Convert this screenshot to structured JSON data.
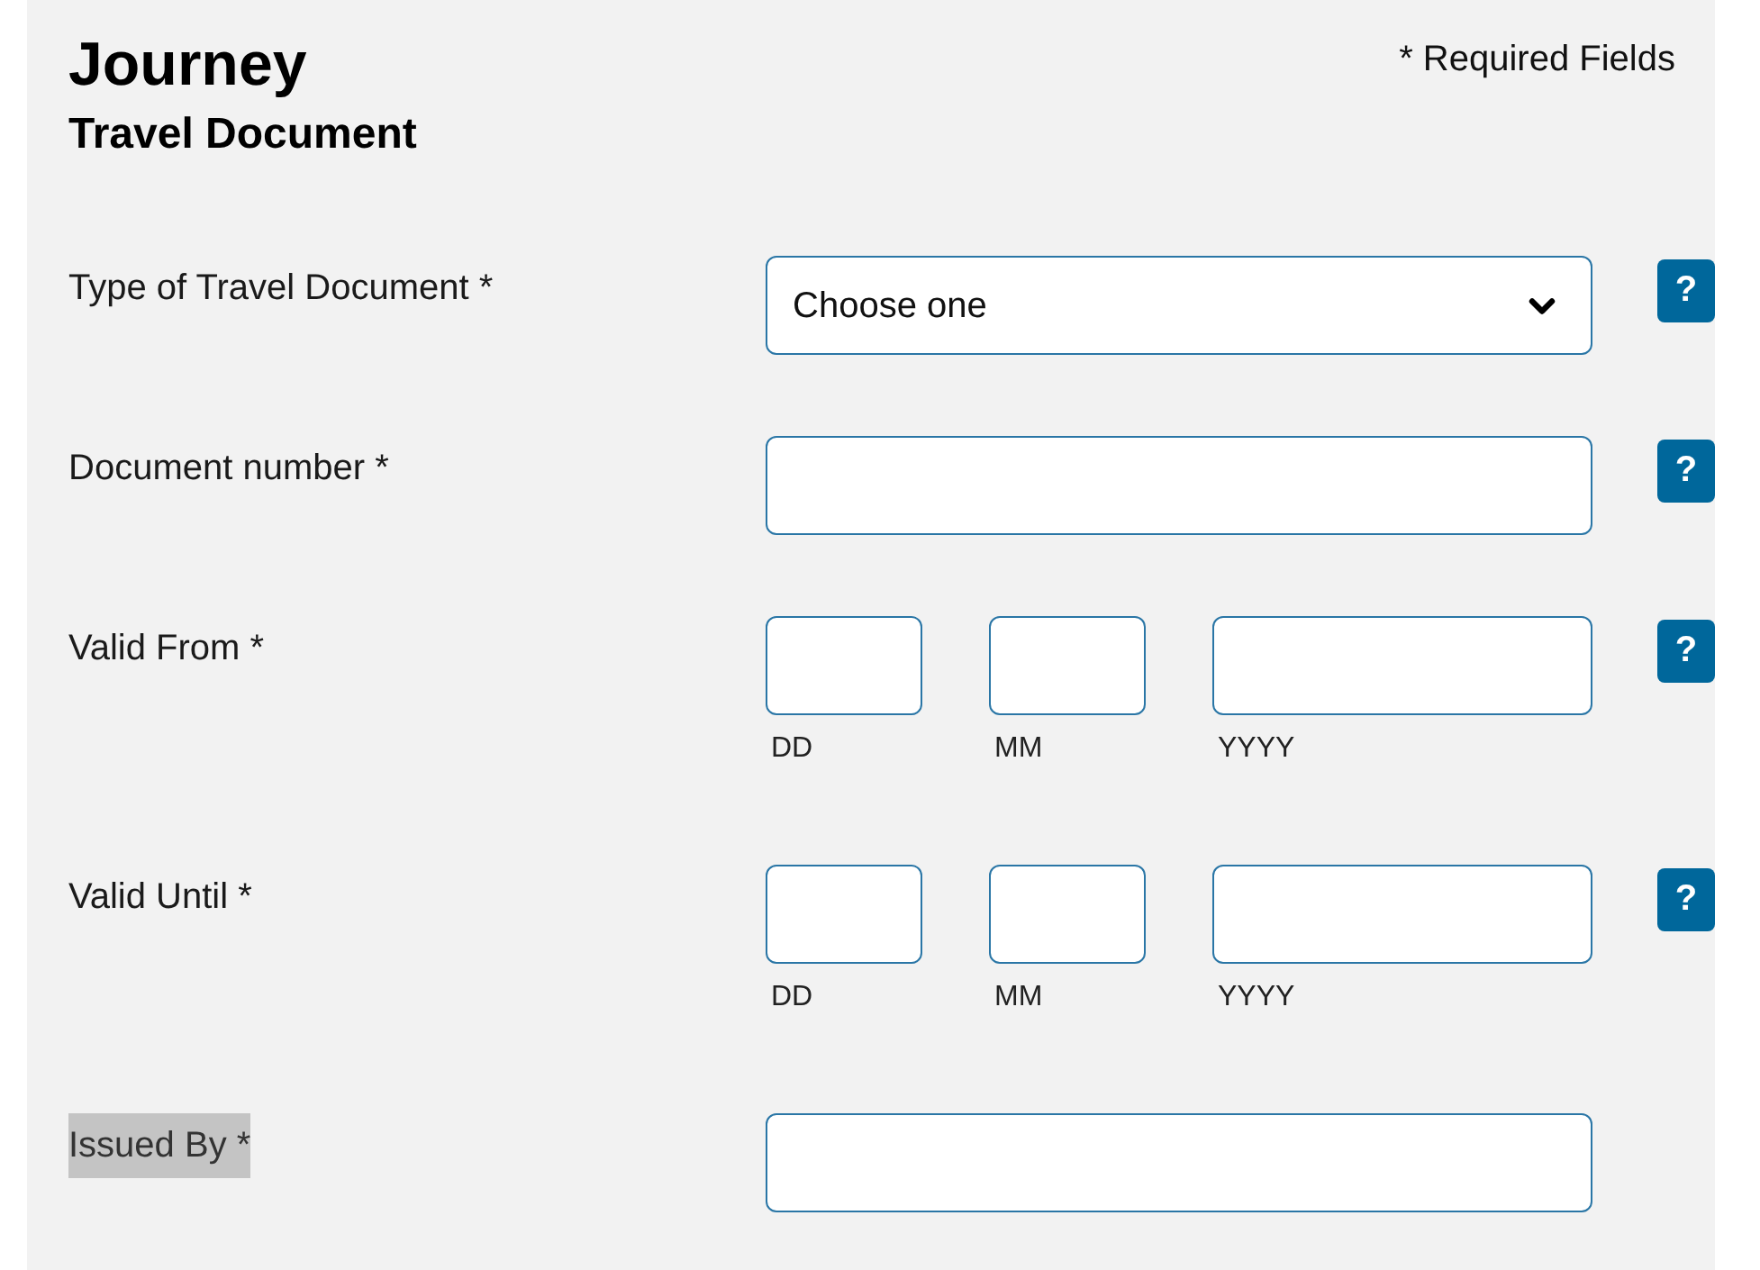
{
  "header": {
    "title": "Journey",
    "subtitle": "Travel Document",
    "required_note": "* Required Fields"
  },
  "fields": [
    {
      "kind": "select",
      "label": "Type of Travel Document *",
      "highlighted": false,
      "value": "Choose one",
      "help": "?"
    },
    {
      "kind": "text",
      "label": "Document number *",
      "highlighted": false,
      "help": "?"
    },
    {
      "kind": "date",
      "label": "Valid From *",
      "highlighted": false,
      "parts": [
        {
          "caption": "DD"
        },
        {
          "caption": "MM"
        },
        {
          "caption": "YYYY"
        }
      ],
      "help": "?"
    },
    {
      "kind": "date",
      "label": "Valid Until *",
      "highlighted": false,
      "parts": [
        {
          "caption": "DD"
        },
        {
          "caption": "MM"
        },
        {
          "caption": "YYYY"
        }
      ],
      "help": "?"
    },
    {
      "kind": "text",
      "label": "Issued By *",
      "highlighted": true
    }
  ]
}
